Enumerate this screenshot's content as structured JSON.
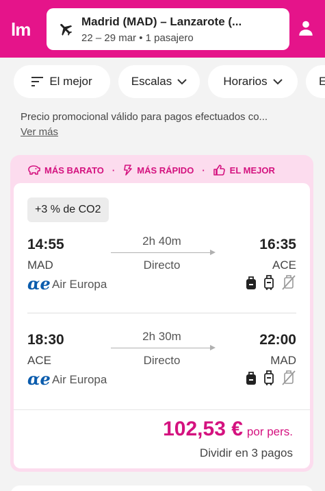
{
  "header": {
    "logo": "lm",
    "route": "Madrid (MAD) – Lanzarote (...",
    "details": "22 – 29 mar • 1 pasajero",
    "icons": {
      "plane": "plane-icon",
      "user": "user-icon"
    },
    "brand_color": "#e5148a"
  },
  "filters": [
    {
      "label": "El mejor",
      "icon": "sort-icon"
    },
    {
      "label": "Escalas",
      "icon": "chevron-down-icon"
    },
    {
      "label": "Horarios",
      "icon": "chevron-down-icon"
    },
    {
      "label": "E"
    }
  ],
  "promo": {
    "text": "Precio promocional válido para pagos efectuados co...",
    "link": "Ver más"
  },
  "result": {
    "tags": [
      {
        "label": "MÁS BARATO",
        "icon": "piggy-bank-icon"
      },
      {
        "label": "MÁS RÁPIDO",
        "icon": "lightning-icon"
      },
      {
        "label": "EL MEJOR",
        "icon": "thumbs-up-icon"
      }
    ],
    "tag_separator": "·",
    "co2": "+3 % de CO2",
    "segments": [
      {
        "dep_time": "14:55",
        "dep_code": "MAD",
        "duration": "2h 40m",
        "stops": "Directo",
        "arr_time": "16:35",
        "arr_code": "ACE",
        "airline": "Air Europa",
        "airline_logo": "αe"
      },
      {
        "dep_time": "18:30",
        "dep_code": "ACE",
        "duration": "2h 30m",
        "stops": "Directo",
        "arr_time": "22:00",
        "arr_code": "MAD",
        "airline": "Air Europa",
        "airline_logo": "αe"
      }
    ],
    "baggage_icons": [
      "personal-bag-icon",
      "cabin-bag-icon",
      "checked-bag-unavailable-icon"
    ],
    "price": "102,53 €",
    "price_suffix": "por pers.",
    "installments": "Dividir en 3 pagos",
    "accent_color": "#d4127f"
  }
}
